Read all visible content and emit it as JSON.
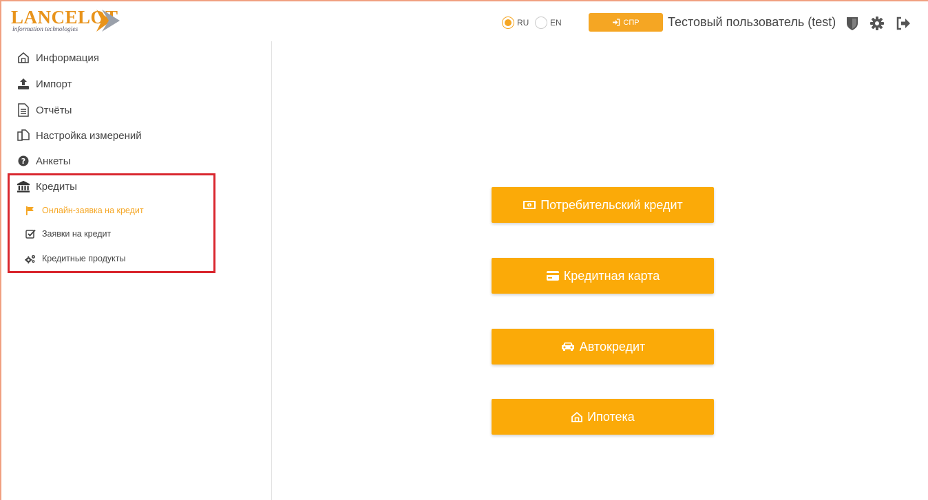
{
  "header": {
    "logo_text": "LANCELOT",
    "logo_subtitle": "information technologies",
    "languages": [
      {
        "label": "RU",
        "selected": true
      },
      {
        "label": "EN",
        "selected": false
      }
    ],
    "spr_button_label": "СПР",
    "user_name": "Тестовый пользователь (test)",
    "icons": [
      "shield-icon",
      "gear-icon",
      "logout-icon"
    ]
  },
  "sidebar": {
    "items": [
      {
        "label": "Информация",
        "icon": "home-icon"
      },
      {
        "label": "Импорт",
        "icon": "upload-icon"
      },
      {
        "label": "Отчёты",
        "icon": "document-icon"
      },
      {
        "label": "Настройка измерений",
        "icon": "copy-icon"
      },
      {
        "label": "Анкеты",
        "icon": "question-circle-icon"
      },
      {
        "label": "Кредиты",
        "icon": "bank-icon"
      }
    ],
    "credit_subitems": [
      {
        "label": "Онлайн-заявка на кредит",
        "icon": "flag-icon",
        "active": true
      },
      {
        "label": "Заявки на кредит",
        "icon": "check-square-icon",
        "active": false
      },
      {
        "label": "Кредитные продукты",
        "icon": "gears-icon",
        "active": false
      }
    ]
  },
  "main": {
    "buttons": [
      {
        "label": "Потребительский кредит",
        "icon": "money-icon"
      },
      {
        "label": "Кредитная карта",
        "icon": "credit-card-icon"
      },
      {
        "label": "Автокредит",
        "icon": "car-icon"
      },
      {
        "label": "Ипотека",
        "icon": "home-icon"
      }
    ]
  },
  "colors": {
    "accent": "#f5a623",
    "button": "#fbaa08",
    "highlight_border": "#d9262e"
  }
}
